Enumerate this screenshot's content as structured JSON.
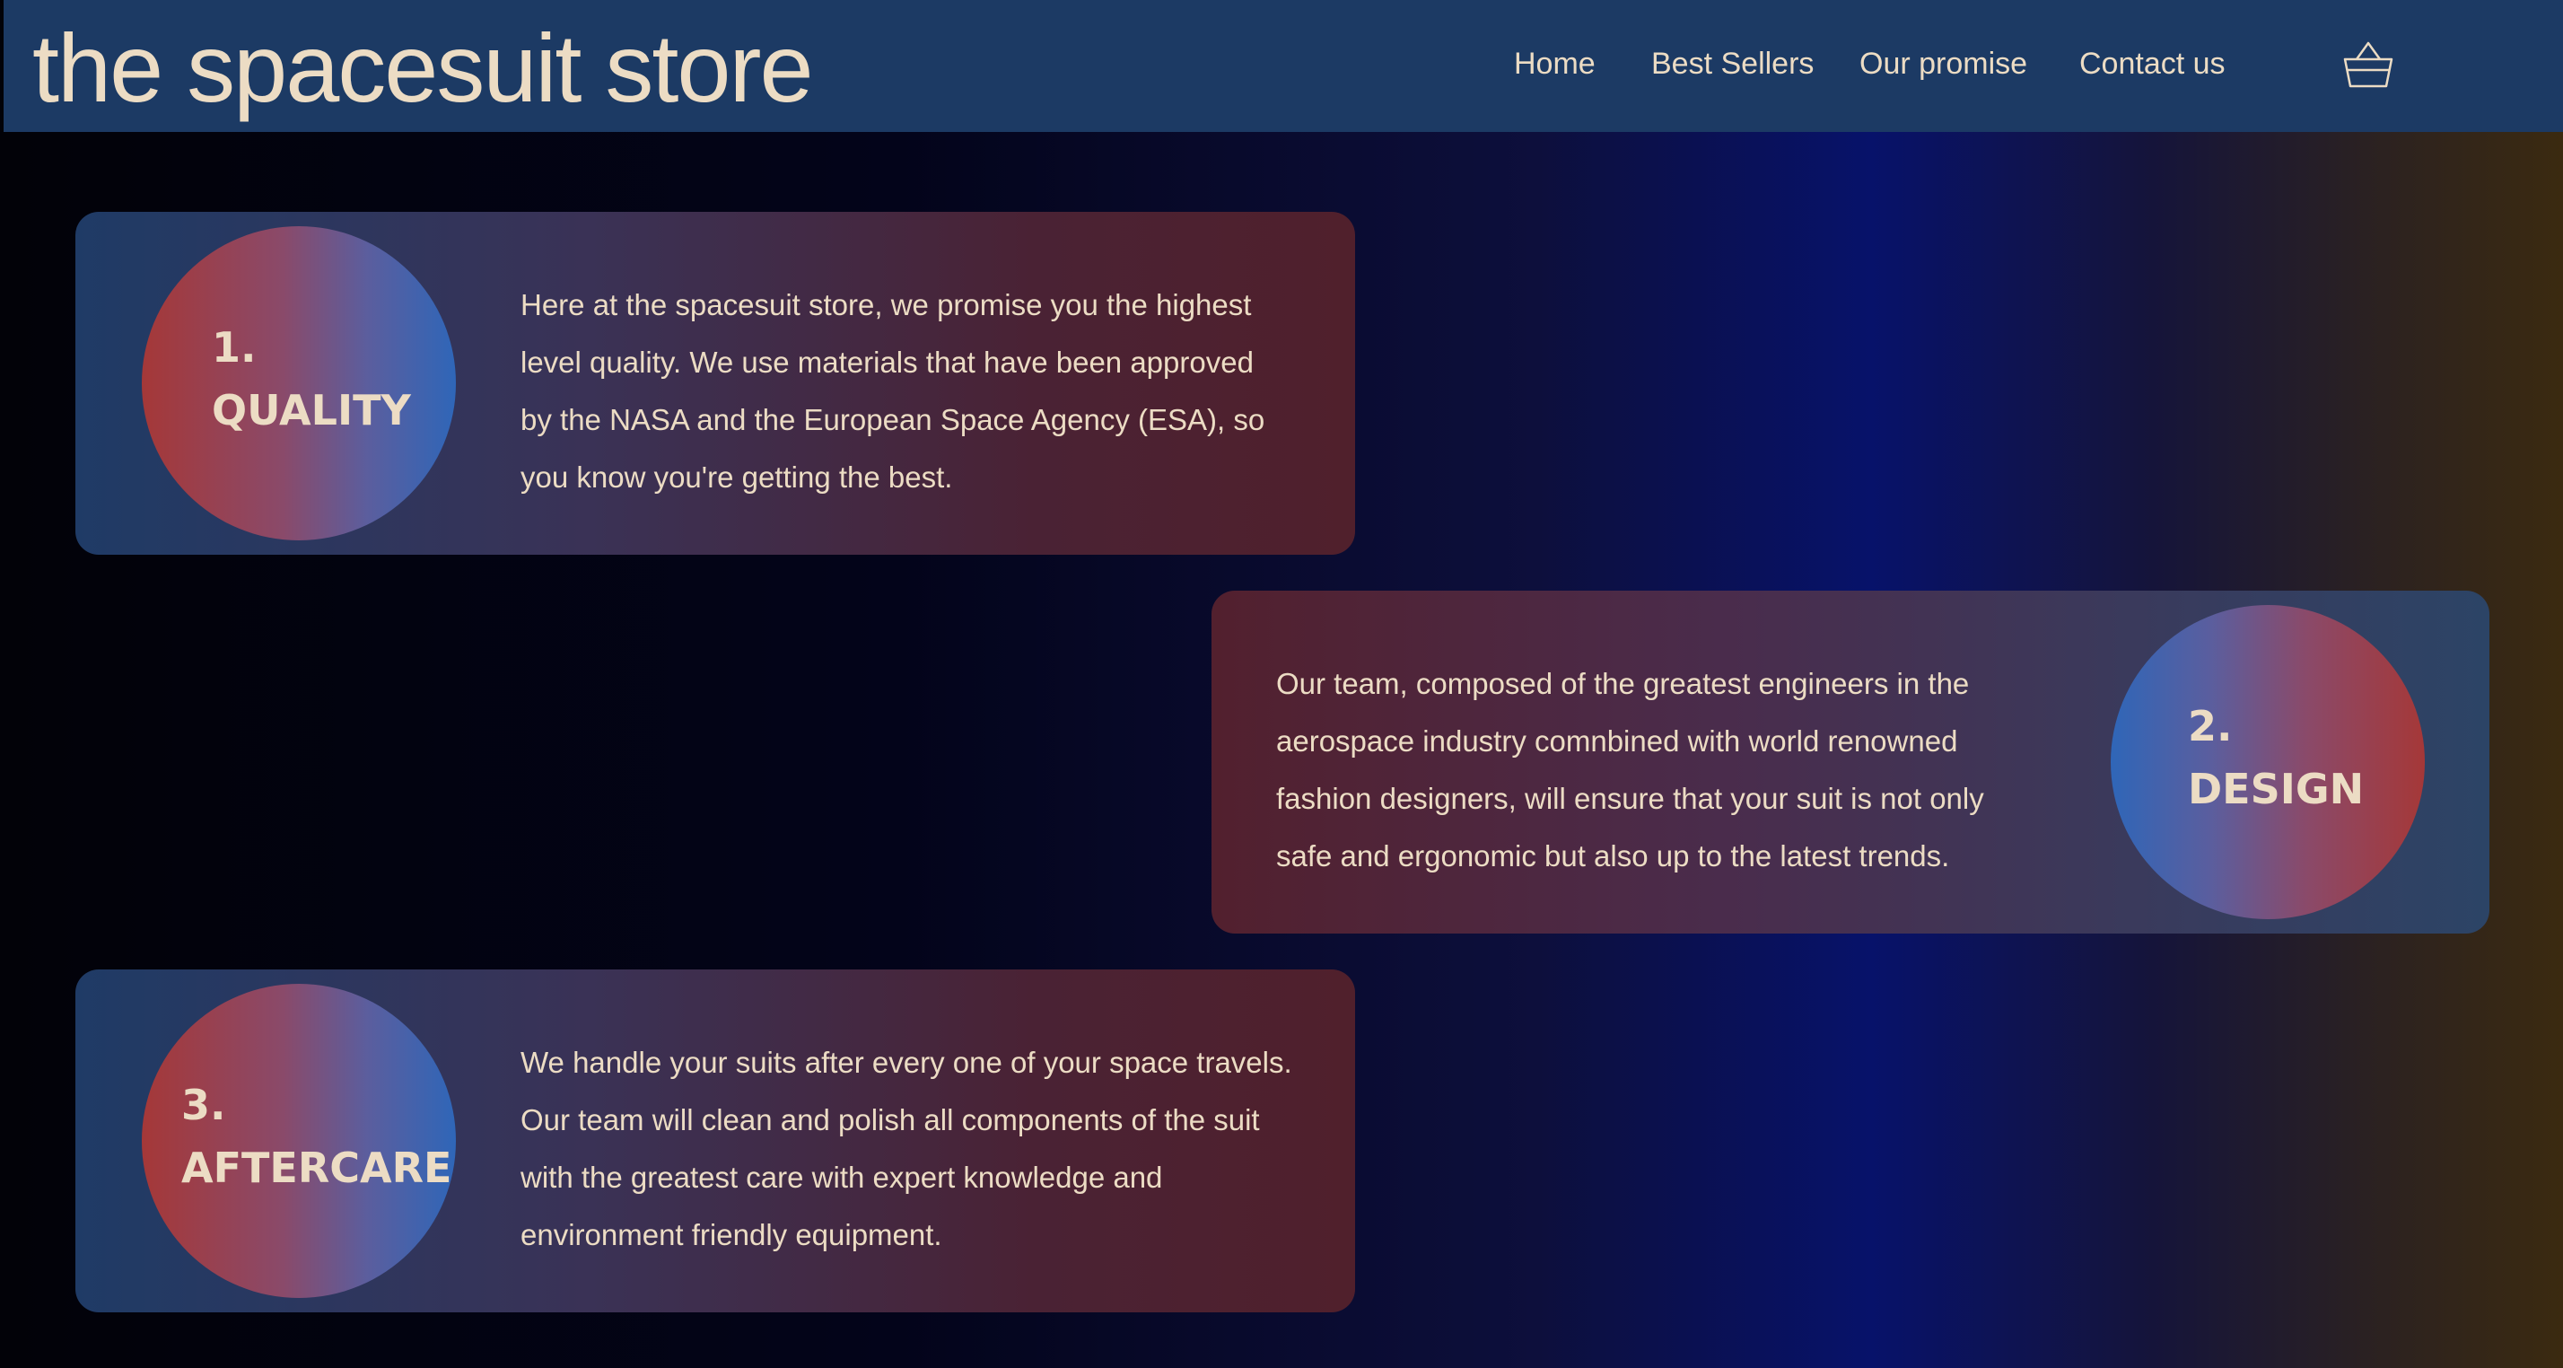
{
  "header": {
    "brand": "the spacesuit store",
    "nav": [
      {
        "label": "Home"
      },
      {
        "label": "Best Sellers"
      },
      {
        "label": "Our promise"
      },
      {
        "label": "Contact us"
      }
    ],
    "cart_icon": "basket-icon"
  },
  "promises": [
    {
      "number": "1.",
      "title": "QUALITY",
      "text": "Here at the spacesuit store, we promise you the highest level quality. We use materials that have been approved by the NASA and the European Space Agency (ESA), so you know you're getting the best."
    },
    {
      "number": "2.",
      "title": "DESIGN",
      "text": "Our team, composed of the greatest engineers in the aerospace industry comnbined with world renowned fashion designers, will ensure that your suit is not only safe and ergonomic but also up to the latest trends."
    },
    {
      "number": "3.",
      "title": "AFTERCARE",
      "text": "We handle your suits after every one of your space travels. Our team will clean and polish all components of the suit with the greatest care with expert knowledge and environment friendly equipment."
    }
  ],
  "colors": {
    "header_bg": "#1c3a64",
    "text": "#ecdcc4",
    "circle_red": "#a53838",
    "circle_blue": "#2f66b8"
  }
}
